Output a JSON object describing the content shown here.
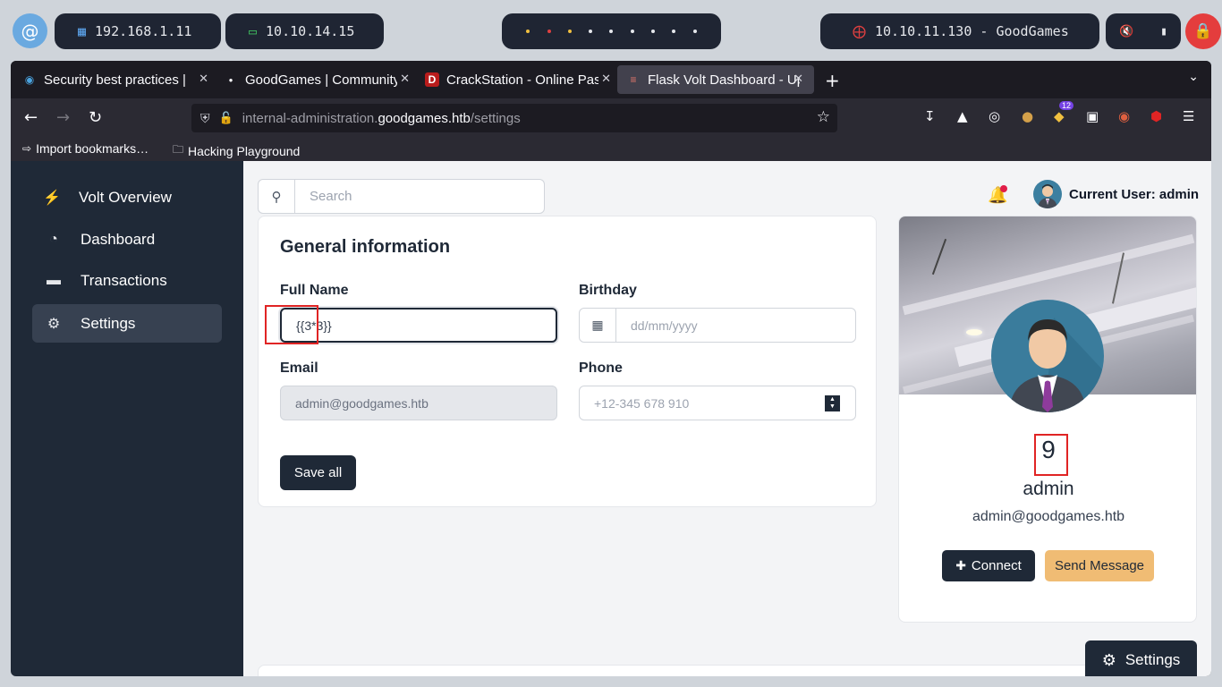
{
  "system_bar": {
    "ip_local": "192.168.1.11",
    "ip_vpn": "10.10.14.15",
    "target": "10.10.11.130 - GoodGames",
    "icons": [
      "debian-logo-icon",
      "network-icon",
      "laptop-icon",
      "target-icon",
      "mute-icon",
      "battery-icon",
      "lock-icon"
    ]
  },
  "browser": {
    "tabs": [
      {
        "title": "Security best practices | ",
        "favicon": "firefox-icon"
      },
      {
        "title": "GoodGames | Community an",
        "favicon": "dot-icon"
      },
      {
        "title": "CrackStation - Online Pas",
        "favicon": "crackstation-icon"
      },
      {
        "title": "Flask Volt Dashboard - Up",
        "favicon": "flask-icon",
        "active": true
      }
    ],
    "url": {
      "subdomain": "internal-administration.",
      "domain": "goodgames.htb",
      "path": "/settings"
    },
    "bookmarks": [
      {
        "label": "Import bookmarks…",
        "icon": "import-icon"
      },
      {
        "label": "Hacking Playground",
        "icon": "folder-icon"
      }
    ],
    "extension_badge": "12"
  },
  "sidebar": {
    "items": [
      {
        "label": "Volt Overview",
        "icon": "bolt-icon"
      },
      {
        "label": "Dashboard",
        "icon": "pie-chart-icon"
      },
      {
        "label": "Transactions",
        "icon": "credit-card-icon"
      },
      {
        "label": "Settings",
        "icon": "gear-icon",
        "active": true
      }
    ]
  },
  "header": {
    "search_placeholder": "Search",
    "current_user": "Current User: admin"
  },
  "general": {
    "title": "General information",
    "full_name_label": "Full Name",
    "full_name_value": "{{3*3}}",
    "birthday_label": "Birthday",
    "birthday_placeholder": "dd/mm/yyyy",
    "email_label": "Email",
    "email_value": "admin@goodgames.htb",
    "phone_label": "Phone",
    "phone_placeholder": "+12-345 678 910",
    "save_label": "Save all"
  },
  "profile": {
    "rendered_value": "9",
    "name": "admin",
    "email": "admin@goodgames.htb",
    "connect_label": "Connect",
    "message_label": "Send Message"
  },
  "settings_button": "Settings",
  "colors": {
    "sidebar_bg": "#1f2937",
    "accent_orange": "#f0bc74",
    "highlight_red": "#e02424",
    "notification_red": "#e11d48"
  }
}
